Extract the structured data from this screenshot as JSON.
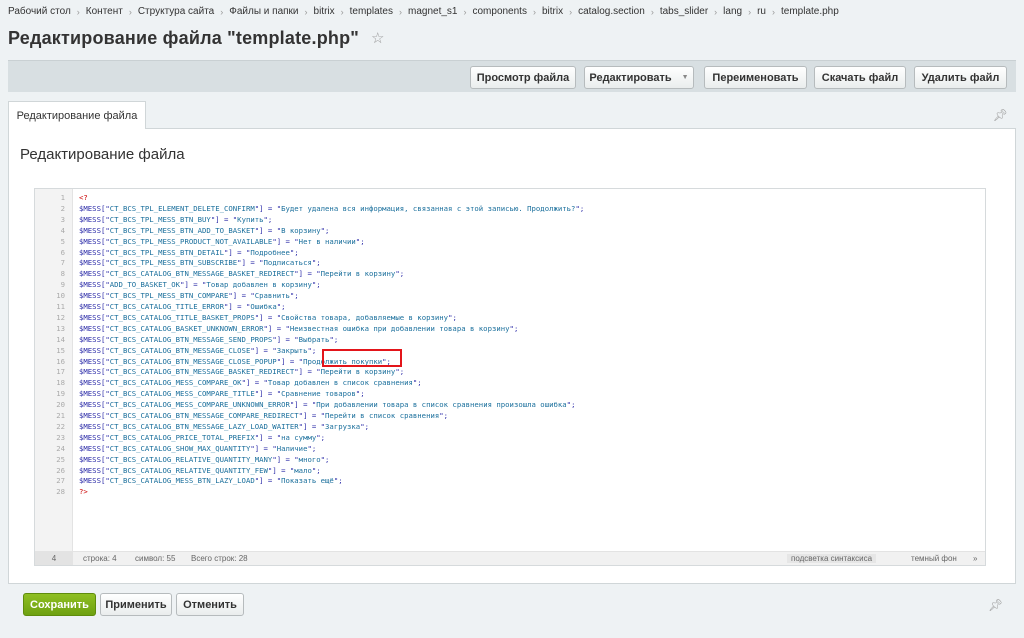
{
  "breadcrumb": [
    "Рабочий стол",
    "Контент",
    "Структура сайта",
    "Файлы и папки",
    "bitrix",
    "templates",
    "magnet_s1",
    "components",
    "bitrix",
    "catalog.section",
    "tabs_slider",
    "lang",
    "ru",
    "template.php"
  ],
  "page_title": "Редактирование файла \"template.php\"",
  "toolbar": {
    "view": "Просмотр файла",
    "edit": "Редактировать",
    "rename": "Переименовать",
    "download": "Скачать файл",
    "delete": "Удалить файл"
  },
  "tab_label": "Редактирование файла",
  "panel_title": "Редактирование файла",
  "code_lines": [
    [
      "<?",
      "",
      ""
    ],
    [
      "$MESS",
      "CT_BCS_TPL_ELEMENT_DELETE_CONFIRM",
      "Будет удалена вся информация, связанная с этой записью. Продолжить?"
    ],
    [
      "$MESS",
      "CT_BCS_TPL_MESS_BTN_BUY",
      "Купить"
    ],
    [
      "$MESS",
      "CT_BCS_TPL_MESS_BTN_ADD_TO_BASKET",
      "В корзину"
    ],
    [
      "$MESS",
      "CT_BCS_TPL_MESS_PRODUCT_NOT_AVAILABLE",
      "Нет в наличии"
    ],
    [
      "$MESS",
      "CT_BCS_TPL_MESS_BTN_DETAIL",
      "Подробнее"
    ],
    [
      "$MESS",
      "CT_BCS_TPL_MESS_BTN_SUBSCRIBE",
      "Подписаться"
    ],
    [
      "$MESS",
      "CT_BCS_CATALOG_BTN_MESSAGE_BASKET_REDIRECT",
      "Перейти в корзину"
    ],
    [
      "$MESS",
      "ADD_TO_BASKET_OK",
      "Товар добавлен в корзину"
    ],
    [
      "$MESS",
      "CT_BCS_TPL_MESS_BTN_COMPARE",
      "Сравнить"
    ],
    [
      "$MESS",
      "CT_BCS_CATALOG_TITLE_ERROR",
      "Ошибка"
    ],
    [
      "$MESS",
      "CT_BCS_CATALOG_TITLE_BASKET_PROPS",
      "Свойства товара, добавляемые в корзину"
    ],
    [
      "$MESS",
      "CT_BCS_CATALOG_BASKET_UNKNOWN_ERROR",
      "Неизвестная ошибка при добавлении товара в корзину"
    ],
    [
      "$MESS",
      "CT_BCS_CATALOG_BTN_MESSAGE_SEND_PROPS",
      "Выбрать"
    ],
    [
      "$MESS",
      "CT_BCS_CATALOG_BTN_MESSAGE_CLOSE",
      "Закрыть"
    ],
    [
      "$MESS",
      "CT_BCS_CATALOG_BTN_MESSAGE_CLOSE_POPUP",
      "Продолжить покупки"
    ],
    [
      "$MESS",
      "CT_BCS_CATALOG_BTN_MESSAGE_BASKET_REDIRECT",
      "Перейти в корзину"
    ],
    [
      "$MESS",
      "CT_BCS_CATALOG_MESS_COMPARE_OK",
      "Товар добавлен в список сравнения"
    ],
    [
      "$MESS",
      "CT_BCS_CATALOG_MESS_COMPARE_TITLE",
      "Сравнение товаров"
    ],
    [
      "$MESS",
      "CT_BCS_CATALOG_MESS_COMPARE_UNKNOWN_ERROR",
      "При добавлении товара в список сравнения произошла ошибка"
    ],
    [
      "$MESS",
      "CT_BCS_CATALOG_BTN_MESSAGE_COMPARE_REDIRECT",
      "Перейти в список сравнения"
    ],
    [
      "$MESS",
      "CT_BCS_CATALOG_BTN_MESSAGE_LAZY_LOAD_WAITER",
      "Загрузка"
    ],
    [
      "$MESS",
      "CT_BCS_CATALOG_PRICE_TOTAL_PREFIX",
      "на сумму"
    ],
    [
      "$MESS",
      "CT_BCS_CATALOG_SHOW_MAX_QUANTITY",
      "Наличие"
    ],
    [
      "$MESS",
      "CT_BCS_CATALOG_RELATIVE_QUANTITY_MANY",
      "много"
    ],
    [
      "$MESS",
      "CT_BCS_CATALOG_RELATIVE_QUANTITY_FEW",
      "мало"
    ],
    [
      "$MESS",
      "CT_BCS_CATALOG_MESS_BTN_LAZY_LOAD",
      "Показать ещё"
    ],
    [
      "?>",
      "",
      ""
    ]
  ],
  "status": {
    "cursor_line": "4",
    "line": "строка: 4",
    "symbol": "символ: 55",
    "total": "Всего строк: 28",
    "highlight": "подсветка синтаксиса",
    "theme": "темный фон",
    "more": "»"
  },
  "footer": {
    "save": "Сохранить",
    "apply": "Применить",
    "cancel": "Отменить"
  }
}
